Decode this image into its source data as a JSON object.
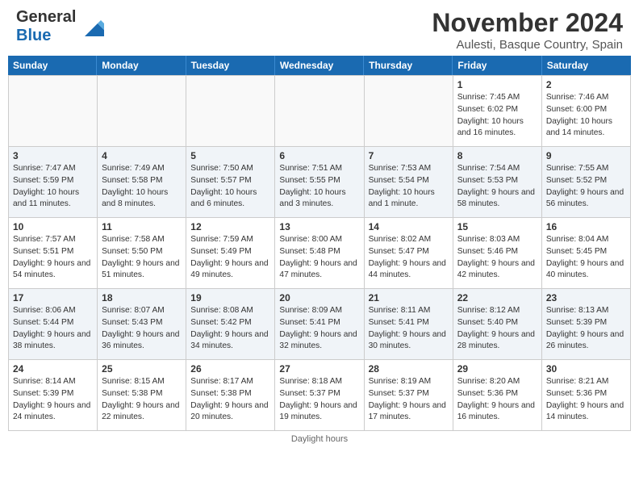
{
  "header": {
    "logo_general": "General",
    "logo_blue": "Blue",
    "month_title": "November 2024",
    "location": "Aulesti, Basque Country, Spain"
  },
  "days_of_week": [
    "Sunday",
    "Monday",
    "Tuesday",
    "Wednesday",
    "Thursday",
    "Friday",
    "Saturday"
  ],
  "weeks": [
    [
      {
        "day": "",
        "info": ""
      },
      {
        "day": "",
        "info": ""
      },
      {
        "day": "",
        "info": ""
      },
      {
        "day": "",
        "info": ""
      },
      {
        "day": "",
        "info": ""
      },
      {
        "day": "1",
        "info": "Sunrise: 7:45 AM\nSunset: 6:02 PM\nDaylight: 10 hours and 16 minutes."
      },
      {
        "day": "2",
        "info": "Sunrise: 7:46 AM\nSunset: 6:00 PM\nDaylight: 10 hours and 14 minutes."
      }
    ],
    [
      {
        "day": "3",
        "info": "Sunrise: 7:47 AM\nSunset: 5:59 PM\nDaylight: 10 hours and 11 minutes."
      },
      {
        "day": "4",
        "info": "Sunrise: 7:49 AM\nSunset: 5:58 PM\nDaylight: 10 hours and 8 minutes."
      },
      {
        "day": "5",
        "info": "Sunrise: 7:50 AM\nSunset: 5:57 PM\nDaylight: 10 hours and 6 minutes."
      },
      {
        "day": "6",
        "info": "Sunrise: 7:51 AM\nSunset: 5:55 PM\nDaylight: 10 hours and 3 minutes."
      },
      {
        "day": "7",
        "info": "Sunrise: 7:53 AM\nSunset: 5:54 PM\nDaylight: 10 hours and 1 minute."
      },
      {
        "day": "8",
        "info": "Sunrise: 7:54 AM\nSunset: 5:53 PM\nDaylight: 9 hours and 58 minutes."
      },
      {
        "day": "9",
        "info": "Sunrise: 7:55 AM\nSunset: 5:52 PM\nDaylight: 9 hours and 56 minutes."
      }
    ],
    [
      {
        "day": "10",
        "info": "Sunrise: 7:57 AM\nSunset: 5:51 PM\nDaylight: 9 hours and 54 minutes."
      },
      {
        "day": "11",
        "info": "Sunrise: 7:58 AM\nSunset: 5:50 PM\nDaylight: 9 hours and 51 minutes."
      },
      {
        "day": "12",
        "info": "Sunrise: 7:59 AM\nSunset: 5:49 PM\nDaylight: 9 hours and 49 minutes."
      },
      {
        "day": "13",
        "info": "Sunrise: 8:00 AM\nSunset: 5:48 PM\nDaylight: 9 hours and 47 minutes."
      },
      {
        "day": "14",
        "info": "Sunrise: 8:02 AM\nSunset: 5:47 PM\nDaylight: 9 hours and 44 minutes."
      },
      {
        "day": "15",
        "info": "Sunrise: 8:03 AM\nSunset: 5:46 PM\nDaylight: 9 hours and 42 minutes."
      },
      {
        "day": "16",
        "info": "Sunrise: 8:04 AM\nSunset: 5:45 PM\nDaylight: 9 hours and 40 minutes."
      }
    ],
    [
      {
        "day": "17",
        "info": "Sunrise: 8:06 AM\nSunset: 5:44 PM\nDaylight: 9 hours and 38 minutes."
      },
      {
        "day": "18",
        "info": "Sunrise: 8:07 AM\nSunset: 5:43 PM\nDaylight: 9 hours and 36 minutes."
      },
      {
        "day": "19",
        "info": "Sunrise: 8:08 AM\nSunset: 5:42 PM\nDaylight: 9 hours and 34 minutes."
      },
      {
        "day": "20",
        "info": "Sunrise: 8:09 AM\nSunset: 5:41 PM\nDaylight: 9 hours and 32 minutes."
      },
      {
        "day": "21",
        "info": "Sunrise: 8:11 AM\nSunset: 5:41 PM\nDaylight: 9 hours and 30 minutes."
      },
      {
        "day": "22",
        "info": "Sunrise: 8:12 AM\nSunset: 5:40 PM\nDaylight: 9 hours and 28 minutes."
      },
      {
        "day": "23",
        "info": "Sunrise: 8:13 AM\nSunset: 5:39 PM\nDaylight: 9 hours and 26 minutes."
      }
    ],
    [
      {
        "day": "24",
        "info": "Sunrise: 8:14 AM\nSunset: 5:39 PM\nDaylight: 9 hours and 24 minutes."
      },
      {
        "day": "25",
        "info": "Sunrise: 8:15 AM\nSunset: 5:38 PM\nDaylight: 9 hours and 22 minutes."
      },
      {
        "day": "26",
        "info": "Sunrise: 8:17 AM\nSunset: 5:38 PM\nDaylight: 9 hours and 20 minutes."
      },
      {
        "day": "27",
        "info": "Sunrise: 8:18 AM\nSunset: 5:37 PM\nDaylight: 9 hours and 19 minutes."
      },
      {
        "day": "28",
        "info": "Sunrise: 8:19 AM\nSunset: 5:37 PM\nDaylight: 9 hours and 17 minutes."
      },
      {
        "day": "29",
        "info": "Sunrise: 8:20 AM\nSunset: 5:36 PM\nDaylight: 9 hours and 16 minutes."
      },
      {
        "day": "30",
        "info": "Sunrise: 8:21 AM\nSunset: 5:36 PM\nDaylight: 9 hours and 14 minutes."
      }
    ]
  ],
  "footer": {
    "daylight_label": "Daylight hours"
  }
}
